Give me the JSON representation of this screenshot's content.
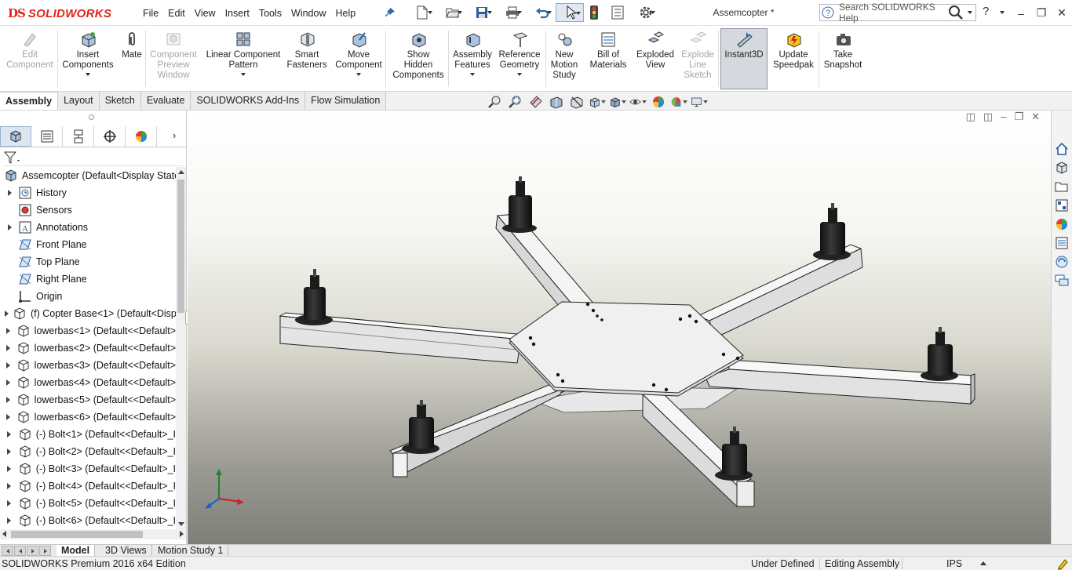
{
  "app": {
    "logo_ds": "DS",
    "logo_text": "SOLIDWORKS",
    "document_title": "Assemcopter *"
  },
  "menu": [
    "File",
    "Edit",
    "View",
    "Insert",
    "Tools",
    "Window",
    "Help"
  ],
  "search": {
    "placeholder": "Search SOLIDWORKS Help"
  },
  "help_label": "?",
  "command_manager": [
    {
      "label": "Edit\nComponent",
      "icon": "edit-component-icon",
      "enabled": false
    },
    {
      "label": "Insert\nComponents",
      "icon": "insert-components-icon",
      "enabled": true,
      "dropdown": true
    },
    {
      "label": "Mate",
      "icon": "mate-paperclip-icon",
      "enabled": true
    },
    {
      "label": "Component\nPreview\nWindow",
      "icon": "component-preview-icon",
      "enabled": false
    },
    {
      "label": "Linear Component\nPattern",
      "icon": "linear-pattern-icon",
      "enabled": true,
      "dropdown": true
    },
    {
      "label": "Smart\nFasteners",
      "icon": "smart-fasteners-icon",
      "enabled": true
    },
    {
      "label": "Move\nComponent",
      "icon": "move-component-icon",
      "enabled": true,
      "dropdown": true
    },
    {
      "label": "Show\nHidden\nComponents",
      "icon": "show-hidden-icon",
      "enabled": true
    },
    {
      "label": "Assembly\nFeatures",
      "icon": "assembly-features-icon",
      "enabled": true,
      "dropdown": true
    },
    {
      "label": "Reference\nGeometry",
      "icon": "reference-geometry-icon",
      "enabled": true,
      "dropdown": true
    },
    {
      "label": "New\nMotion\nStudy",
      "icon": "motion-study-icon",
      "enabled": true
    },
    {
      "label": "Bill of\nMaterials",
      "icon": "bill-of-materials-icon",
      "enabled": true
    },
    {
      "label": "Exploded\nView",
      "icon": "exploded-view-icon",
      "enabled": true
    },
    {
      "label": "Explode\nLine\nSketch",
      "icon": "explode-line-sketch-icon",
      "enabled": false
    },
    {
      "label": "Instant3D",
      "icon": "instant3d-icon",
      "enabled": true,
      "active": true
    },
    {
      "label": "Update\nSpeedpak",
      "icon": "speedpak-icon",
      "enabled": true
    },
    {
      "label": "Take\nSnapshot",
      "icon": "camera-icon",
      "enabled": true
    }
  ],
  "cm_tabs": [
    "Assembly",
    "Layout",
    "Sketch",
    "Evaluate",
    "SOLIDWORKS Add-Ins",
    "Flow Simulation"
  ],
  "feature_tree": {
    "root": "Assemcopter  (Default<Display State-",
    "items": [
      {
        "label": "History",
        "icon": "history-icon",
        "expandable": true
      },
      {
        "label": "Sensors",
        "icon": "sensors-icon",
        "expandable": false
      },
      {
        "label": "Annotations",
        "icon": "annotations-icon",
        "expandable": true
      },
      {
        "label": "Front Plane",
        "icon": "plane-icon",
        "expandable": false
      },
      {
        "label": "Top Plane",
        "icon": "plane-icon",
        "expandable": false
      },
      {
        "label": "Right Plane",
        "icon": "plane-icon",
        "expandable": false
      },
      {
        "label": "Origin",
        "icon": "origin-icon",
        "expandable": false
      },
      {
        "label": "(f) Copter Base<1> (Default<Disp",
        "icon": "part-icon",
        "expandable": true
      },
      {
        "label": "lowerbas<1> (Default<<Default>",
        "icon": "part-icon",
        "expandable": true
      },
      {
        "label": "lowerbas<2> (Default<<Default>",
        "icon": "part-icon",
        "expandable": true
      },
      {
        "label": "lowerbas<3> (Default<<Default>",
        "icon": "part-icon",
        "expandable": true
      },
      {
        "label": "lowerbas<4> (Default<<Default>",
        "icon": "part-icon",
        "expandable": true
      },
      {
        "label": "lowerbas<5> (Default<<Default>",
        "icon": "part-icon",
        "expandable": true
      },
      {
        "label": "lowerbas<6> (Default<<Default>",
        "icon": "part-icon",
        "expandable": true
      },
      {
        "label": "(-) Bolt<1> (Default<<Default>_I",
        "icon": "part-icon",
        "expandable": true
      },
      {
        "label": "(-) Bolt<2> (Default<<Default>_I",
        "icon": "part-icon",
        "expandable": true
      },
      {
        "label": "(-) Bolt<3> (Default<<Default>_I",
        "icon": "part-icon",
        "expandable": true
      },
      {
        "label": "(-) Bolt<4> (Default<<Default>_I",
        "icon": "part-icon",
        "expandable": true
      },
      {
        "label": "(-) Bolt<5> (Default<<Default>_I",
        "icon": "part-icon",
        "expandable": true
      },
      {
        "label": "(-) Bolt<6> (Default<<Default>_I",
        "icon": "part-icon",
        "expandable": true
      }
    ]
  },
  "bottom_tabs": [
    "Model",
    "3D Views",
    "Motion Study 1"
  ],
  "status": {
    "edition": "SOLIDWORKS Premium 2016 x64 Edition",
    "definition": "Under Defined",
    "mode": "Editing Assembly",
    "units": "IPS"
  },
  "colors": {
    "accent": "#e2231a",
    "selection": "#dce6f1"
  }
}
